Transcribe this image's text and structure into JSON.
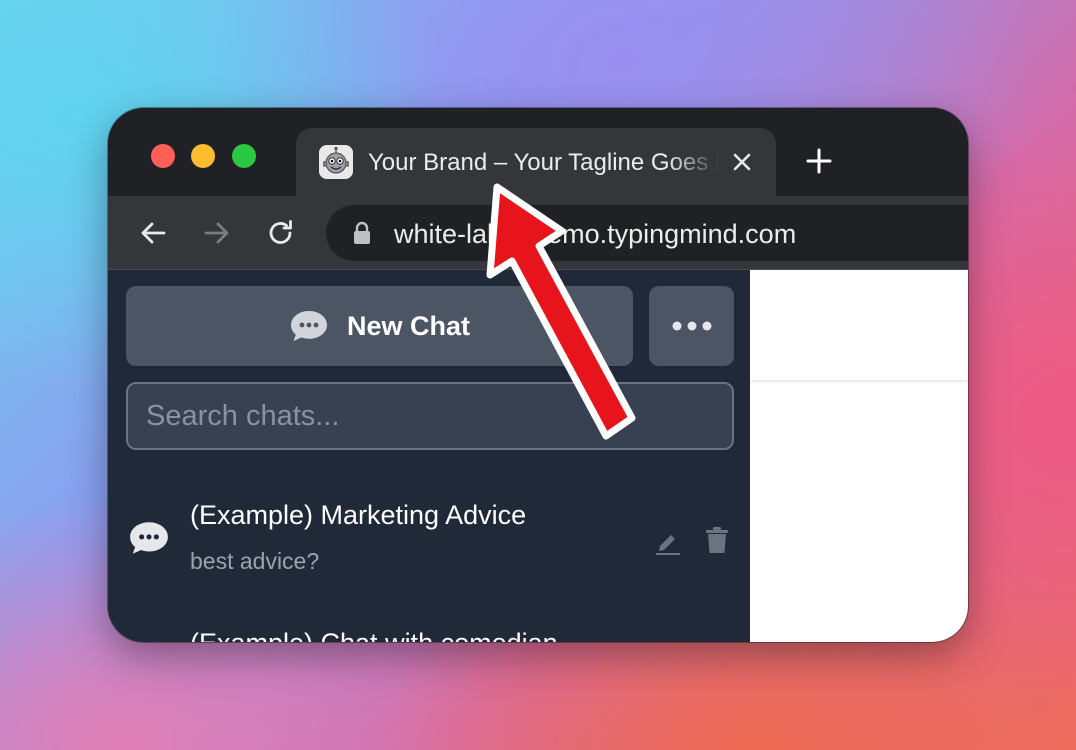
{
  "window": {
    "tab": {
      "title": "Your Brand – Your Tagline Goes Here",
      "favicon": "robot-logo-icon"
    },
    "address_bar": {
      "url": "white-label-demo.typingmind.com"
    }
  },
  "sidebar": {
    "new_chat_label": "New Chat",
    "search_placeholder": "Search chats...",
    "chats": [
      {
        "title": "(Example) Marketing Advice",
        "preview": "best advice?"
      },
      {
        "title": "(Example) Chat with comedian",
        "preview": ""
      }
    ]
  },
  "annotation": {
    "type": "arrow",
    "color": "#e8141b",
    "points_to": "browser-tab-title"
  },
  "colors": {
    "sidebar_bg": "#1f2937",
    "button_bg": "#4b5563",
    "tab_bg": "#35363a",
    "tabstrip_bg": "#202124"
  }
}
